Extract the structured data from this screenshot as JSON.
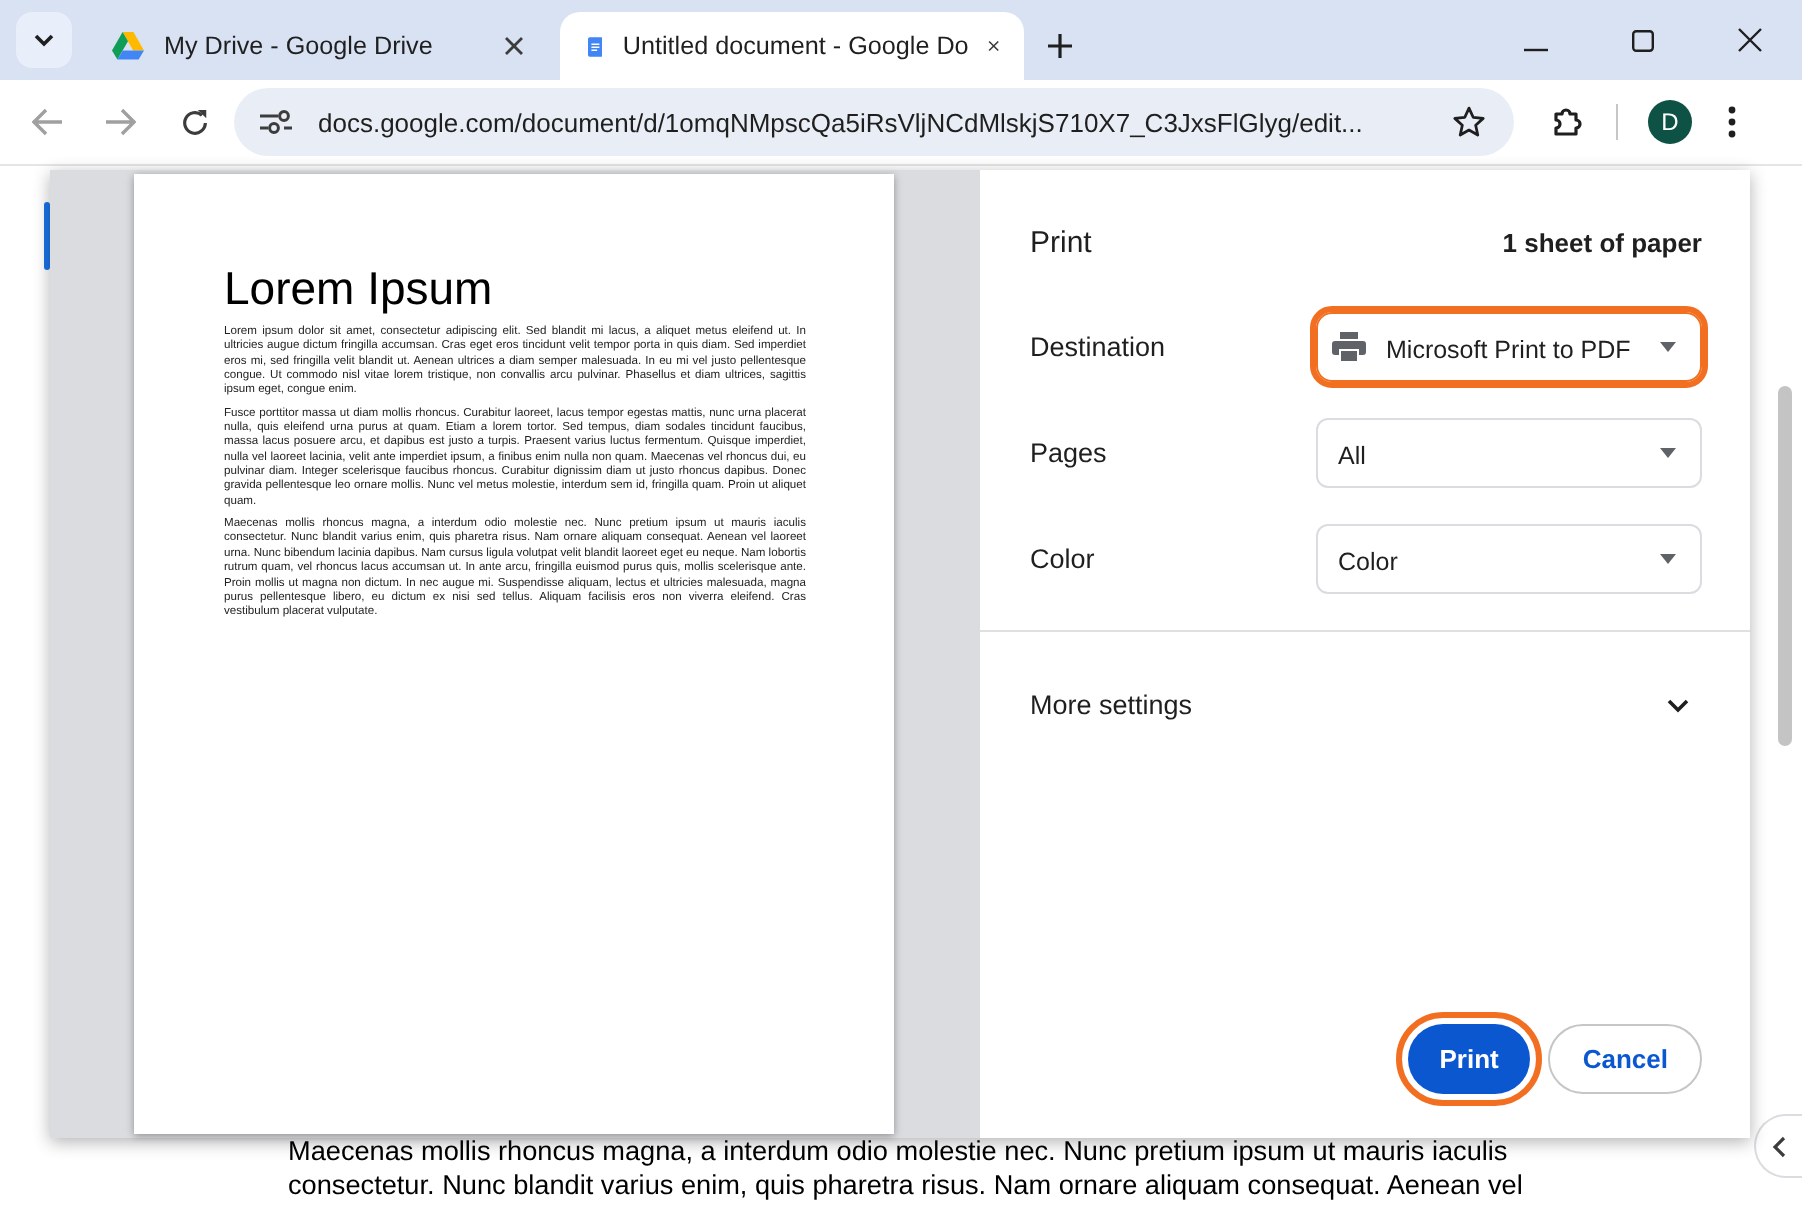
{
  "tabs": [
    {
      "title": "My Drive - Google Drive",
      "selected": false
    },
    {
      "title": "Untitled document - Google Do",
      "selected": true
    }
  ],
  "address_bar": {
    "url": "docs.google.com/document/d/1omqNMpscQa5iRsVljNCdMlskjS710X7_C3JxsFlGlyg/edit..."
  },
  "profile": {
    "initial": "D"
  },
  "document_text": [
    "Maecenas mollis rhoncus magna, a interdum odio molestie nec. Nunc pretium ipsum ut mauris iaculis",
    "consectetur. Nunc blandit varius enim, quis pharetra risus. Nam ornare aliquam consequat. Aenean vel"
  ],
  "print_preview": {
    "heading": "Lorem Ipsum",
    "paragraphs": [
      "Lorem ipsum dolor sit amet, consectetur adipiscing elit. Sed blandit mi lacus, a aliquet metus eleifend ut. In ultricies augue dictum fringilla accumsan. Cras eget eros tincidunt velit tempor porta in quis diam. Sed imperdiet eros mi, sed fringilla velit blandit ut. Aenean ultrices a diam semper malesuada. In eu mi vel justo pellentesque congue. Ut commodo nisl vitae lorem tristique, non convallis arcu pulvinar. Phasellus et diam ultrices, sagittis ipsum eget, congue enim.",
      "Fusce porttitor massa ut diam mollis rhoncus. Curabitur laoreet, lacus tempor egestas mattis, nunc urna placerat nulla, quis eleifend urna purus at quam. Etiam a lorem tortor. Sed tempus, diam sodales tincidunt faucibus, massa lacus posuere arcu, et dapibus est justo a turpis. Praesent varius luctus fermentum. Quisque imperdiet, nulla vel laoreet lacinia, velit ante imperdiet ipsum, a finibus enim nulla non quam. Maecenas vel rhoncus dui, eu pulvinar diam. Integer scelerisque faucibus rhoncus. Curabitur dignissim diam ut justo rhoncus dapibus. Donec gravida pellentesque leo ornare mollis. Nunc vel metus molestie, interdum sem id, fringilla quam. Proin ut aliquet quam.",
      "Maecenas mollis rhoncus magna, a interdum odio molestie nec. Nunc pretium ipsum ut mauris iaculis consectetur. Nunc blandit varius enim, quis pharetra risus. Nam ornare aliquam consequat. Aenean vel laoreet urna. Nunc bibendum lacinia dapibus. Nam cursus ligula volutpat velit blandit laoreet eget eu neque. Nam lobortis rutrum quam, vel rhoncus lacus accumsan ut. In ante arcu, fringilla euismod purus quis, mollis scelerisque ante. Proin mollis ut magna non dictum. In nec augue mi. Suspendisse aliquam, lectus et ultricies malesuada, magna purus pellentesque libero, eu dictum ex nisi sed tellus. Aliquam facilisis eros non viverra eleifend. Cras vestibulum placerat vulputate."
    ]
  },
  "print_dialog": {
    "title": "Print",
    "sheet_count": "1 sheet of paper",
    "settings": [
      {
        "label": "Destination",
        "value": "Microsoft Print to PDF",
        "highlighted": true
      },
      {
        "label": "Pages",
        "value": "All",
        "highlighted": false
      },
      {
        "label": "Color",
        "value": "Color",
        "highlighted": false
      }
    ],
    "more_settings": "More settings",
    "buttons": [
      {
        "label": "Print",
        "kind": "primary",
        "highlighted": true
      },
      {
        "label": "Cancel",
        "kind": "secondary",
        "highlighted": false
      }
    ]
  }
}
